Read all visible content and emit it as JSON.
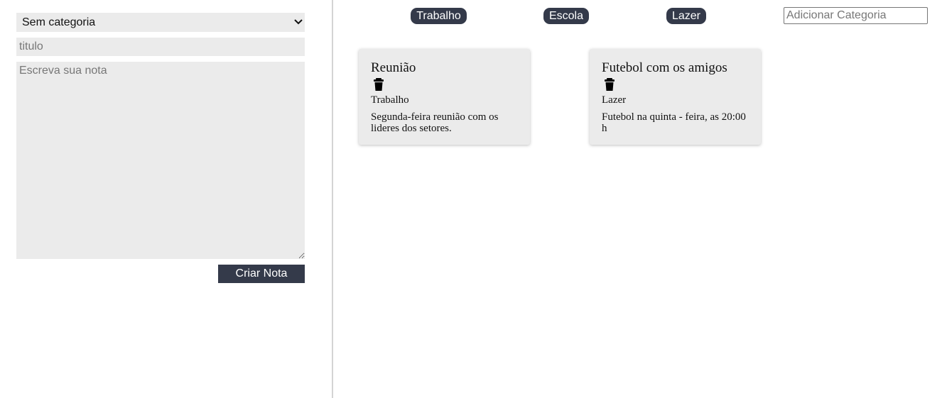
{
  "form": {
    "category_select": {
      "selected": "Sem categoria",
      "options": [
        "Sem categoria",
        "Trabalho",
        "Escola",
        "Lazer"
      ]
    },
    "title_placeholder": "titulo",
    "note_placeholder": "Escreva sua nota",
    "create_button_label": "Criar Nota"
  },
  "categories": [
    "Trabalho",
    "Escola",
    "Lazer"
  ],
  "add_category_placeholder": "Adicionar Categoria",
  "notes": [
    {
      "title": "Reunião",
      "category": "Trabalho",
      "body": "Segunda-feira reunião com os lideres dos setores.",
      "delete_icon": "trash-icon"
    },
    {
      "title": "Futebol com os amigos",
      "category": "Lazer",
      "body": "Futebol na quinta - feira, as 20:00 h",
      "delete_icon": "trash-icon"
    }
  ],
  "colors": {
    "accent": "#343a4a",
    "field_background": "#ebebeb",
    "divider": "#d4d4d4"
  }
}
